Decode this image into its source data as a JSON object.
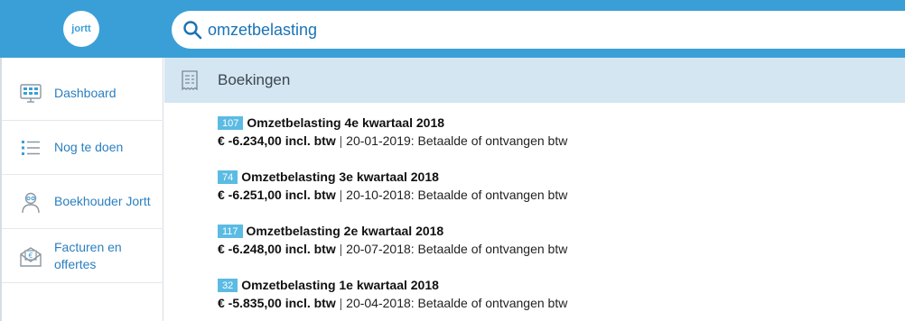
{
  "app": {
    "logo_text": "jortt"
  },
  "search": {
    "value": "omzetbelasting",
    "placeholder": ""
  },
  "sidebar": {
    "items": [
      {
        "label": "Dashboard",
        "icon": "dashboard-monitor-icon"
      },
      {
        "label": "Nog te doen",
        "icon": "todo-list-icon"
      },
      {
        "label": "Boekhouder Jortt",
        "icon": "accountant-person-icon"
      },
      {
        "label": "Facturen en offertes",
        "icon": "invoice-envelope-icon"
      }
    ]
  },
  "results": {
    "section_title": "Boekingen",
    "section_icon": "receipt-icon",
    "items": [
      {
        "badge": "107",
        "title": "Omzetbelasting 4e kwartaal 2018",
        "amount": "€ -6.234,00 incl. btw",
        "separator": "|",
        "detail": "20-01-2019: Betaalde of ontvangen btw"
      },
      {
        "badge": "74",
        "title": "Omzetbelasting 3e kwartaal 2018",
        "amount": "€ -6.251,00 incl. btw",
        "separator": "|",
        "detail": "20-10-2018: Betaalde of ontvangen btw"
      },
      {
        "badge": "117",
        "title": "Omzetbelasting 2e kwartaal 2018",
        "amount": "€ -6.248,00 incl. btw",
        "separator": "|",
        "detail": "20-07-2018: Betaalde of ontvangen btw"
      },
      {
        "badge": "32",
        "title": "Omzetbelasting 1e kwartaal 2018",
        "amount": "€ -5.835,00 incl. btw",
        "separator": "|",
        "detail": "20-04-2018: Betaalde of ontvangen btw"
      }
    ]
  },
  "colors": {
    "brand": "#3a9fd6",
    "badge": "#5bbbe3",
    "section_bg": "#d4e6f1",
    "link": "#2a7fbf"
  }
}
